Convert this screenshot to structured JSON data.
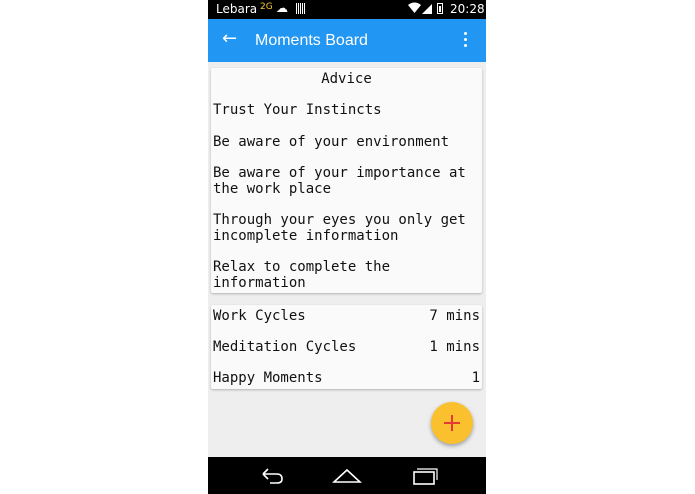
{
  "status_bar": {
    "carrier": "Lebara",
    "network": "2G",
    "time": "20:28",
    "icons": [
      "cloud-upload-icon",
      "sim-icon",
      "wifi-icon",
      "signal-icon",
      "battery-icon"
    ]
  },
  "app_bar": {
    "title": "Moments Board",
    "background": "#2196f3",
    "icons": [
      "back-arrow-icon",
      "overflow-menu-icon"
    ]
  },
  "advice": {
    "title": "Advice",
    "items": [
      "Trust Your Instincts",
      "Be aware of your environment",
      "Be aware of your importance at the work place",
      "Through your eyes you only get incomplete information",
      "Relax to complete the information"
    ]
  },
  "stats": [
    {
      "label": "Work Cycles",
      "value": "7 mins"
    },
    {
      "label": "Meditation Cycles",
      "value": "1 mins"
    },
    {
      "label": "Happy Moments",
      "value": "1"
    }
  ],
  "fab": {
    "icon": "plus-icon",
    "color": "#fbc02d",
    "icon_color": "#e53935"
  },
  "nav_bar": {
    "icons": [
      "back-icon",
      "home-icon",
      "recents-icon"
    ]
  }
}
